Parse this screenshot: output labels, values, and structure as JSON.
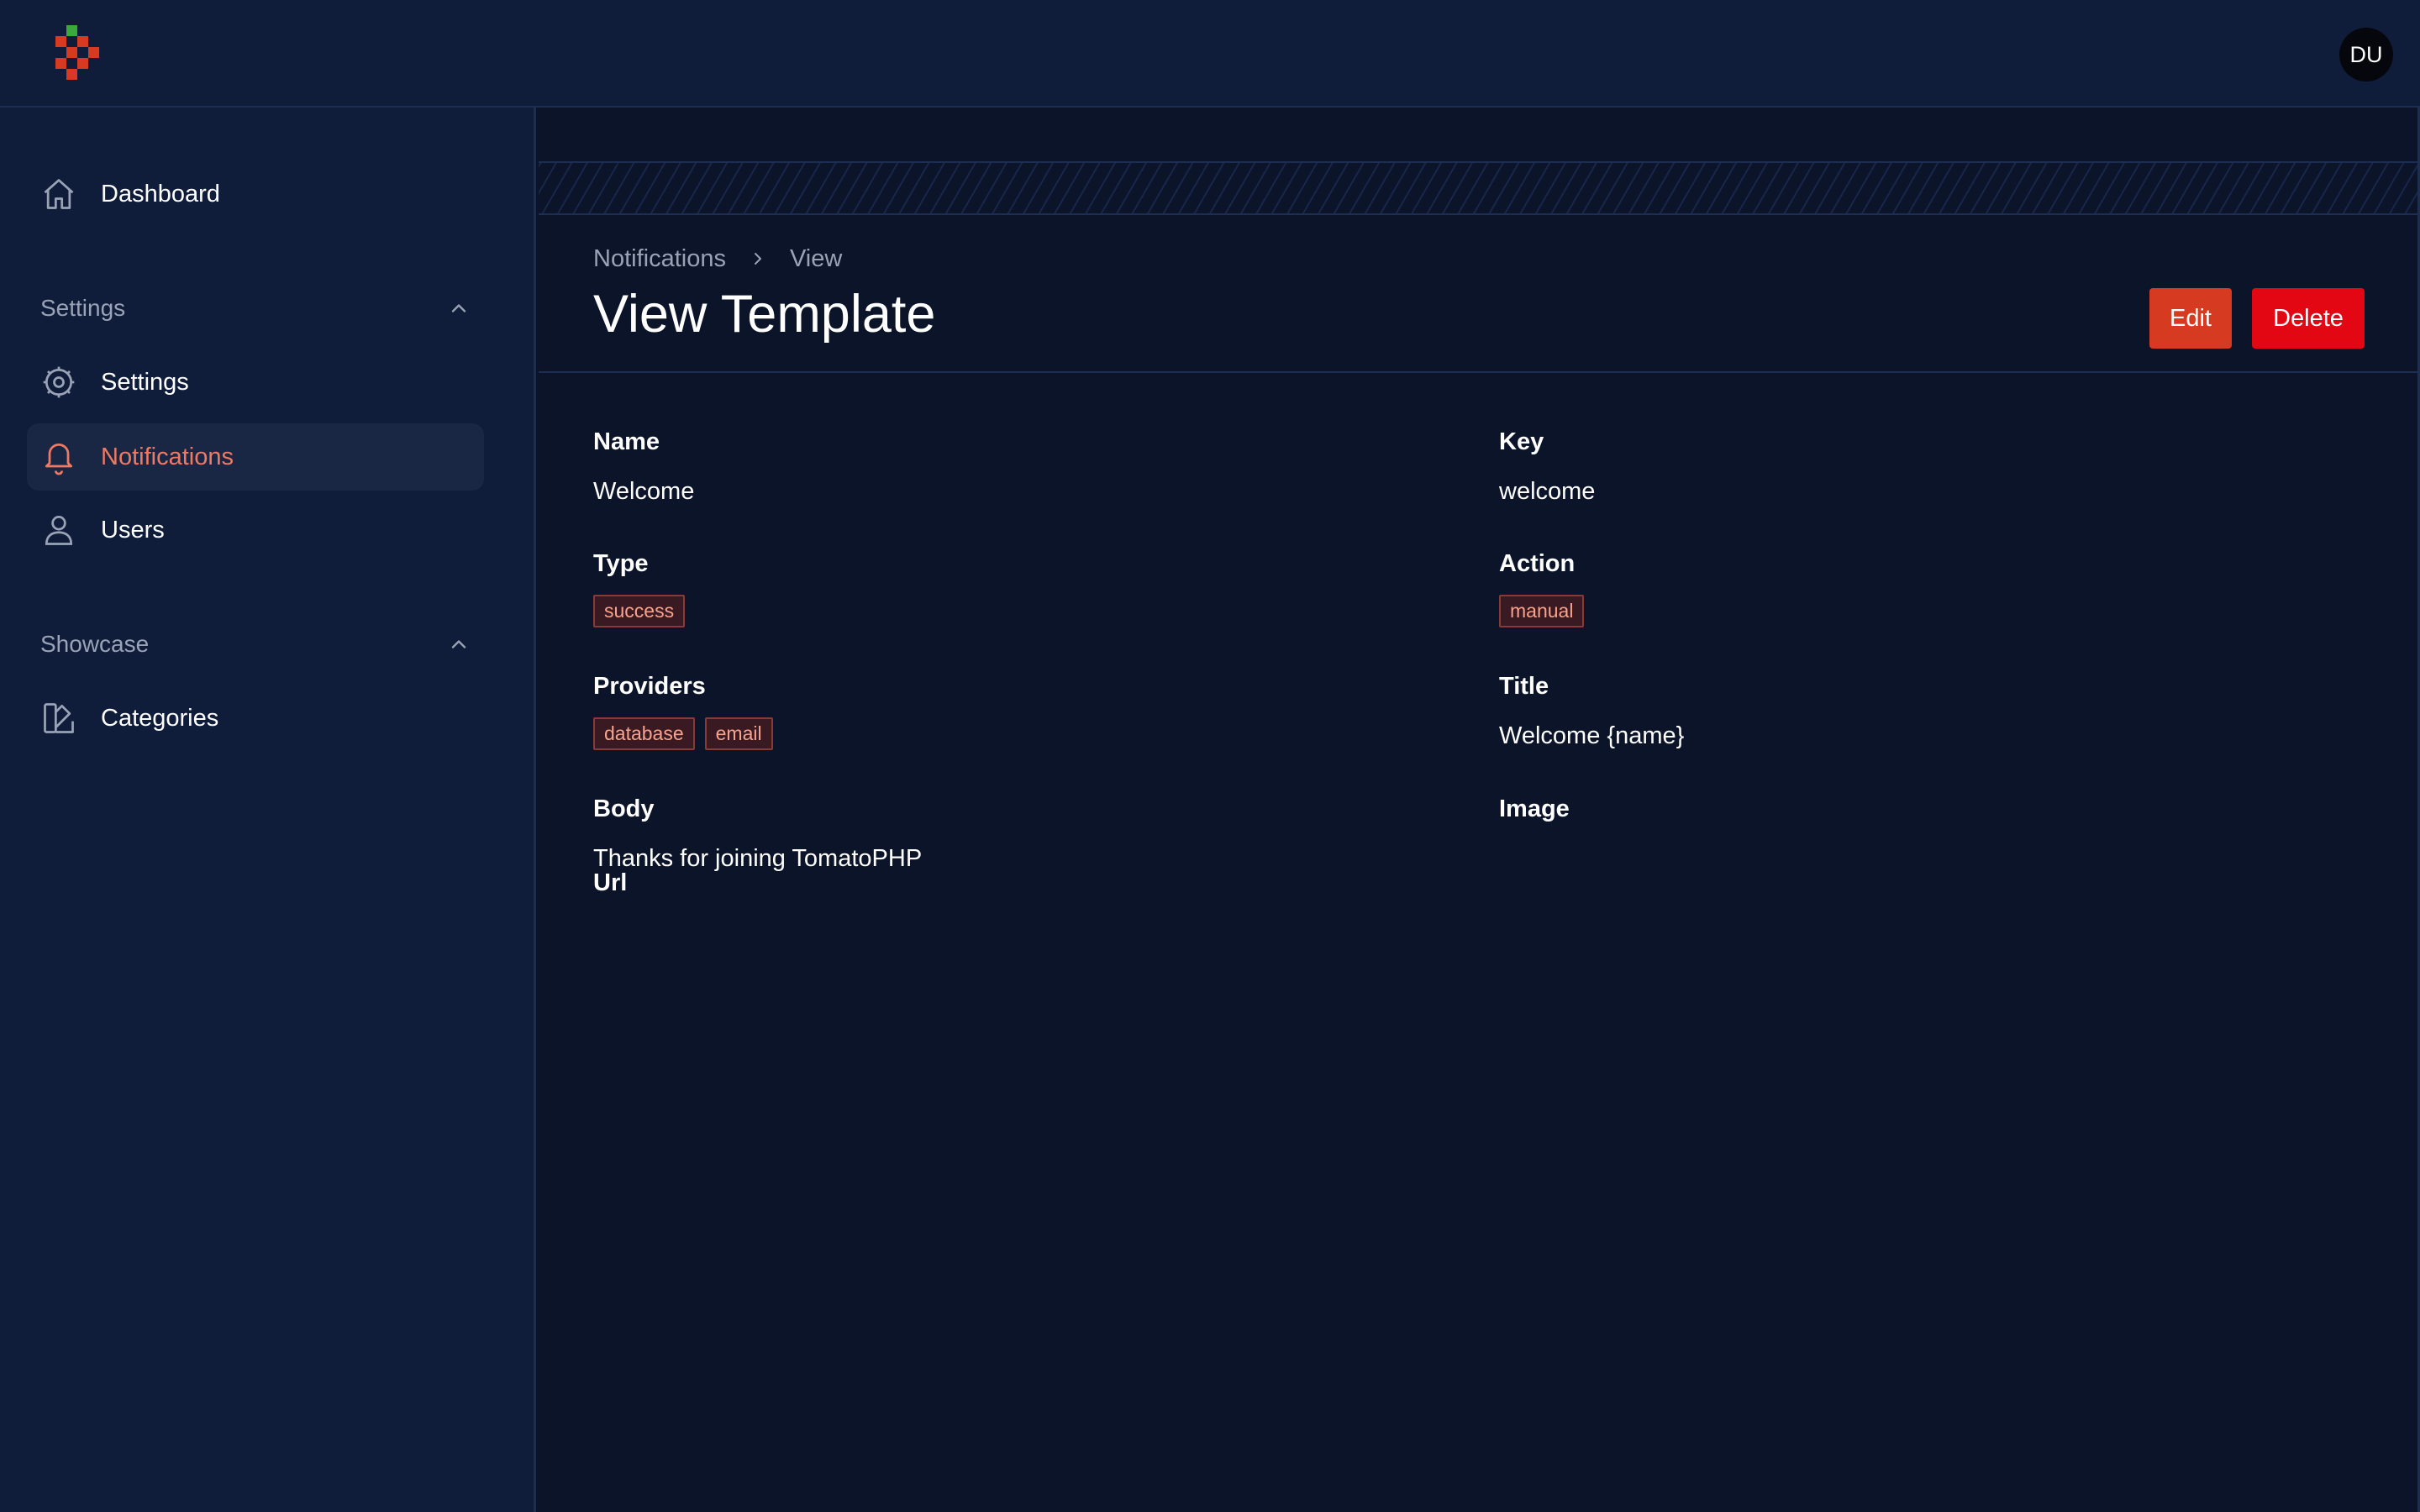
{
  "topbar": {
    "avatar_initials": "DU"
  },
  "sidebar": {
    "dashboard": "Dashboard",
    "groups": [
      {
        "label": "Settings",
        "items": [
          "Settings",
          "Notifications",
          "Users"
        ]
      },
      {
        "label": "Showcase",
        "items": [
          "Categories"
        ]
      }
    ],
    "active_item": "Notifications"
  },
  "breadcrumb": [
    "Notifications",
    "View"
  ],
  "page": {
    "title": "View Template",
    "edit_label": "Edit",
    "delete_label": "Delete"
  },
  "fields": {
    "name": {
      "label": "Name",
      "value": "Welcome"
    },
    "key": {
      "label": "Key",
      "value": "welcome"
    },
    "type": {
      "label": "Type",
      "badges": [
        "success"
      ]
    },
    "action": {
      "label": "Action",
      "badges": [
        "manual"
      ]
    },
    "providers": {
      "label": "Providers",
      "badges": [
        "database",
        "email"
      ]
    },
    "title": {
      "label": "Title",
      "value": "Welcome {name}"
    },
    "body": {
      "label": "Body",
      "value": "Thanks for joining TomatoPHP"
    },
    "image": {
      "label": "Image",
      "value": ""
    },
    "url": {
      "label": "Url",
      "value": ""
    }
  },
  "colors": {
    "accent": "#ef7a63",
    "edit_button": "#d63b22",
    "delete_button": "#e30613",
    "background": "#0b1429",
    "sidebar": "#0f1c3a"
  },
  "icons": {
    "dashboard": "home-icon",
    "settings": "gear-icon",
    "notifications": "bell-icon",
    "users": "user-icon",
    "categories": "swatch-icon"
  }
}
